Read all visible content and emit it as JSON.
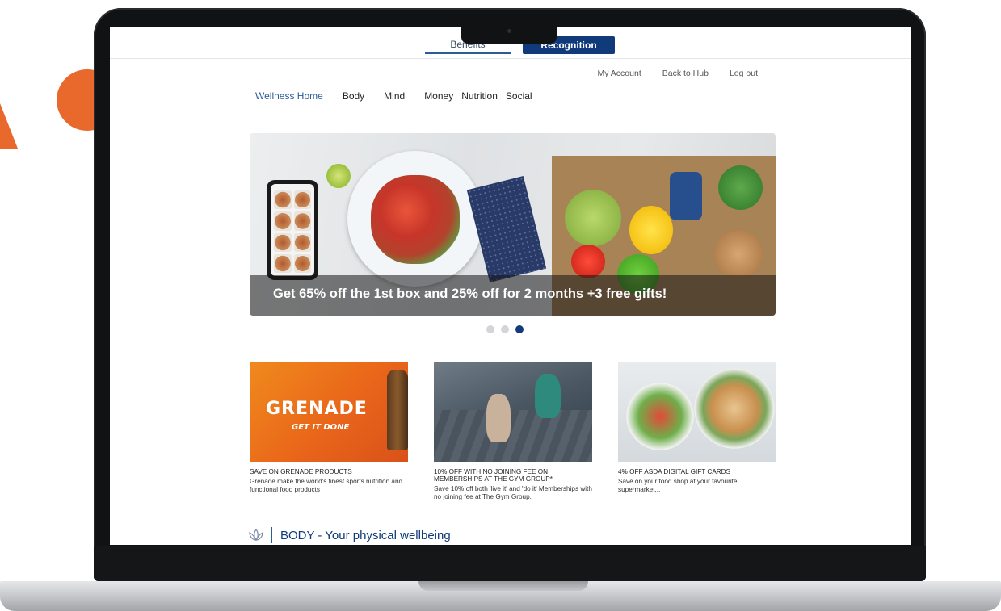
{
  "switch_tabs": {
    "benefits": "Benefits",
    "recognition": "Recognition"
  },
  "account_links": [
    "My Account",
    "Back to Hub",
    "Log out"
  ],
  "main_nav": [
    "Wellness Home",
    "Body",
    "Mind",
    "Money",
    "Nutrition",
    "Social"
  ],
  "hero": {
    "caption": "Get 65% off the 1st box and 25% off for 2 months +3 free gifts!",
    "slide_count": 3,
    "active_slide": 3
  },
  "cards": [
    {
      "image_text": "GRENADE",
      "image_tagline": "GET IT DONE",
      "title": "SAVE ON GRENADE PRODUCTS",
      "description": "Grenade make the world's finest sports nutrition and functional food products"
    },
    {
      "title": "10% OFF WITH NO JOINING FEE ON MEMBERSHIPS AT THE GYM GROUP*",
      "description": "Save 10% off both 'live it' and 'do it' Memberships with no joining fee at The Gym Group."
    },
    {
      "title": "4% OFF ASDA DIGITAL GIFT CARDS",
      "description": "Save on your food shop at your favourite supermarket..."
    }
  ],
  "body_section": {
    "heading": "BODY - Your physical wellbeing",
    "icon": "lotus-icon"
  },
  "colors": {
    "brand_navy": "#113a7a",
    "accent_blue": "#2d5b97",
    "deco_orange": "#e8692b"
  }
}
